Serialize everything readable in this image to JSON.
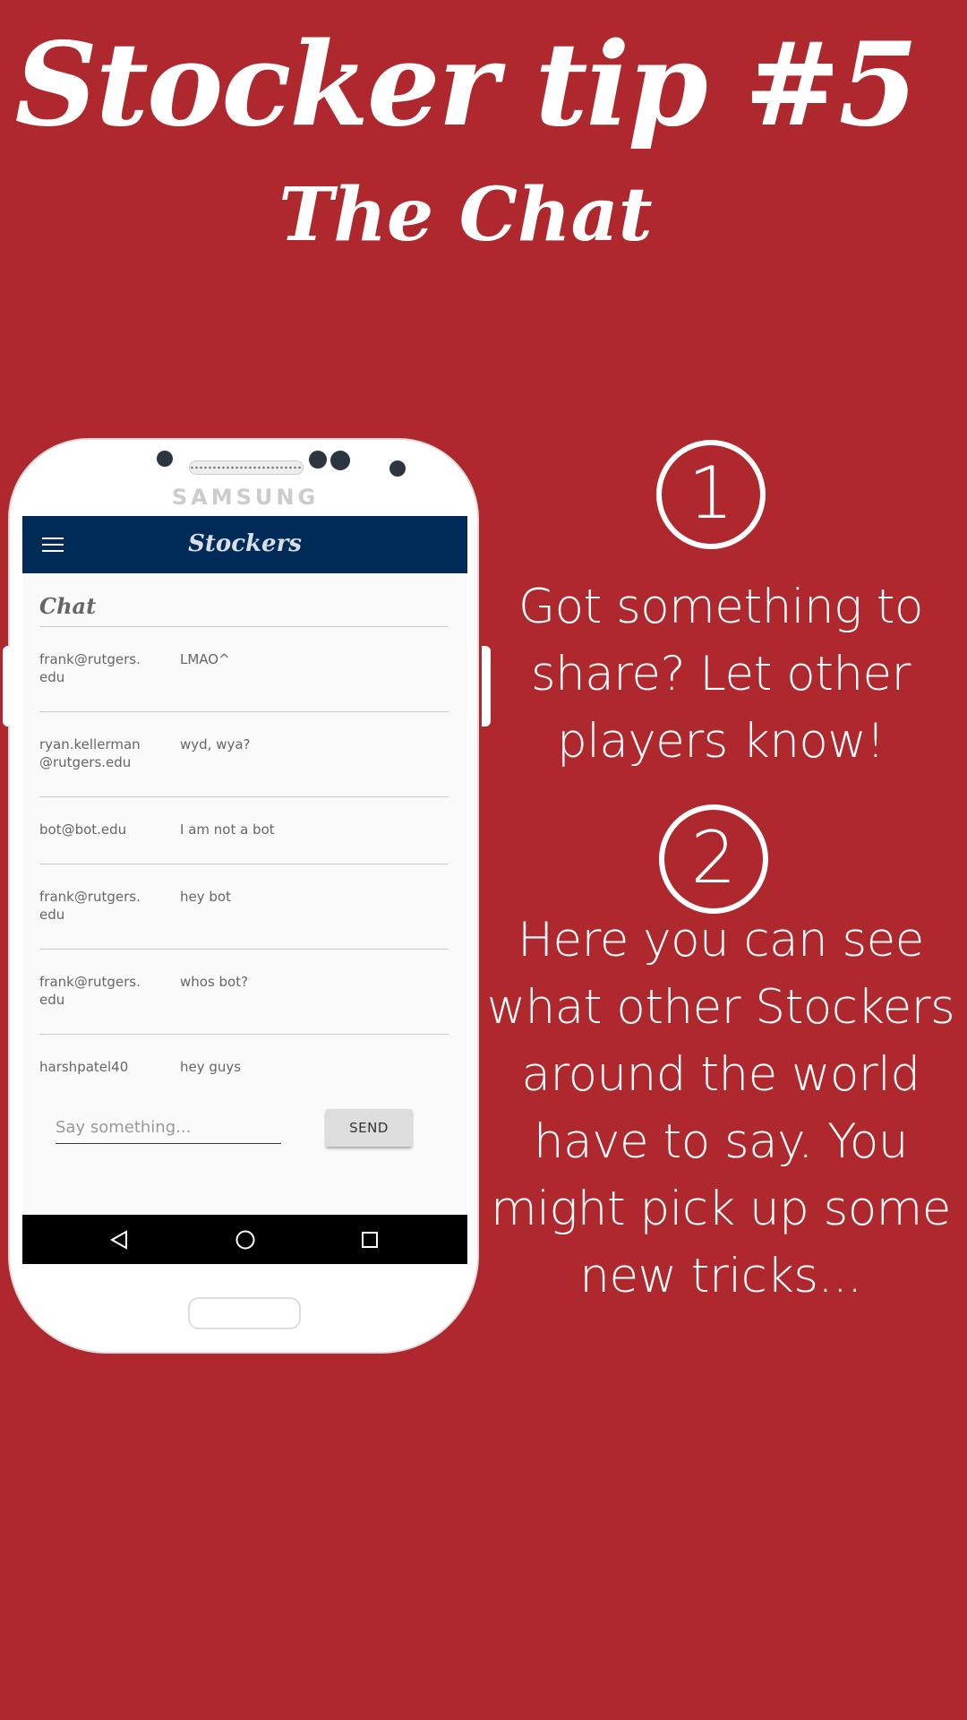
{
  "header": {
    "title": "Stocker tip #5",
    "subtitle": "The Chat"
  },
  "phone": {
    "brand": "SAMSUNG",
    "app_title": "Stockers",
    "section_title": "Chat",
    "messages": [
      {
        "user": "frank@rutgers.edu",
        "text": "LMAO^"
      },
      {
        "user": "ryan.kellerman@rutgers.edu",
        "text": "wyd, wya?"
      },
      {
        "user": "bot@bot.edu",
        "text": "I am not a bot"
      },
      {
        "user": "frank@rutgers.edu",
        "text": "hey bot"
      },
      {
        "user": "frank@rutgers.edu",
        "text": "whos bot?"
      },
      {
        "user": "harshpatel40",
        "text": "hey guys"
      }
    ],
    "input_placeholder": "Say something...",
    "send_label": "SEND"
  },
  "steps": [
    {
      "number": "1",
      "text": "Got something to share? Let other players know!"
    },
    {
      "number": "2",
      "text": "Here you can see what other Stockers around the world have to say. You might pick up some new tricks..."
    }
  ],
  "colors": {
    "background": "#ae282e",
    "appbar": "#002a57"
  },
  "icons": [
    "menu-icon",
    "back-icon",
    "home-icon",
    "recents-icon"
  ]
}
